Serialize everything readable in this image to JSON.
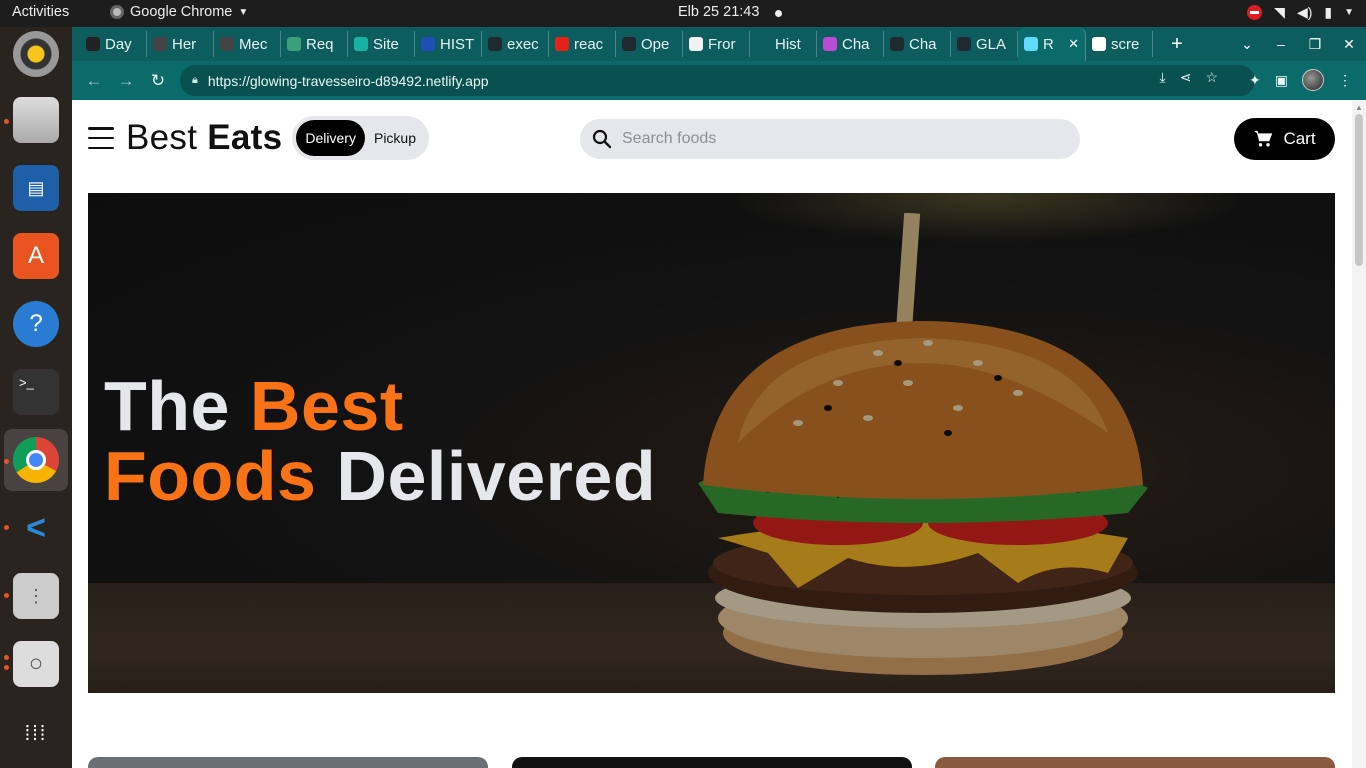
{
  "system": {
    "activities": "Activities",
    "app_name": "Google Chrome",
    "clock": "Elb 25  21:43"
  },
  "browser": {
    "tabs": [
      {
        "label": "Day",
        "fav": "#222"
      },
      {
        "label": "Her",
        "fav": "#444"
      },
      {
        "label": "Mec",
        "fav": "#444"
      },
      {
        "label": "Req",
        "fav": "#3aa07a"
      },
      {
        "label": "Site",
        "fav": "#16b3a3"
      },
      {
        "label": "HIST",
        "fav": "#1f4fb5"
      },
      {
        "label": "exec",
        "fav": "#1e2a30"
      },
      {
        "label": "reac",
        "fav": "#e62117"
      },
      {
        "label": "Ope",
        "fav": "#1e2a30"
      },
      {
        "label": "Fror",
        "fav": "#f2f2f2"
      },
      {
        "label": "Hist",
        "fav": "#0d5d5e"
      },
      {
        "label": "Cha",
        "fav": "#b84cd6"
      },
      {
        "label": "Cha",
        "fav": "#1e2a30"
      },
      {
        "label": "GLA",
        "fav": "#1e2a30"
      },
      {
        "label": "R",
        "fav": "#61dafb"
      },
      {
        "label": "scre",
        "fav": "#ffffff"
      }
    ],
    "url": "https://glowing-travesseiro-d89492.netlify.app"
  },
  "site": {
    "brand_regular": "Best",
    "brand_bold": "Eats",
    "toggle": {
      "delivery": "Delivery",
      "pickup": "Pickup"
    },
    "search_placeholder": "Search foods",
    "cart_label": "Cart",
    "hero": {
      "line1_white": "The",
      "line1_orange": "Best",
      "line2_orange": "Foods",
      "line2_white": "Delivered"
    },
    "accent_color": "#f97316"
  }
}
